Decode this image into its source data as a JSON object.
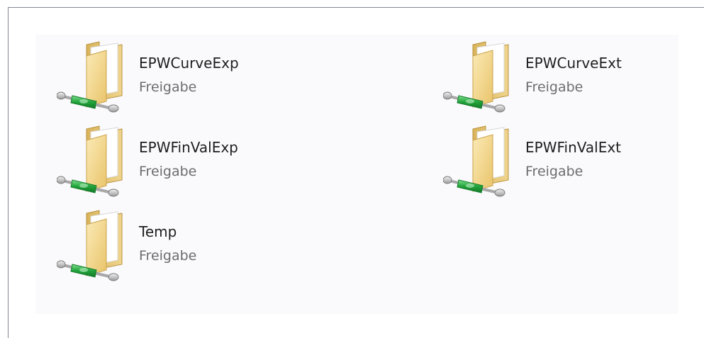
{
  "shares": [
    {
      "name": "EPWCurveExp",
      "type": "Freigabe",
      "icon": "network-share-folder-icon"
    },
    {
      "name": "EPWCurveExt",
      "type": "Freigabe",
      "icon": "network-share-folder-icon"
    },
    {
      "name": "EPWFinValExp",
      "type": "Freigabe",
      "icon": "network-share-folder-icon"
    },
    {
      "name": "EPWFinValExt",
      "type": "Freigabe",
      "icon": "network-share-folder-icon"
    },
    {
      "name": "Temp",
      "type": "Freigabe",
      "icon": "network-share-folder-icon"
    }
  ],
  "colors": {
    "view_background": "#fafafc",
    "folder_yellow": "#f2d68a",
    "network_cable_green": "#2fb14a"
  }
}
